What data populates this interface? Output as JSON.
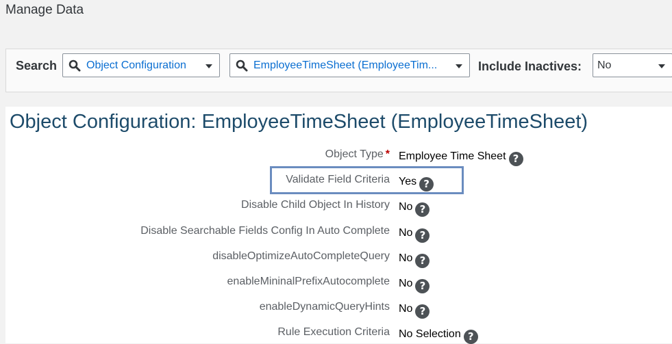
{
  "page": {
    "title": "Manage Data"
  },
  "search": {
    "label": "Search",
    "type_combo": {
      "value": "Object Configuration"
    },
    "object_combo": {
      "value": "EmployeeTimeSheet (EmployeeTim..."
    },
    "inactives_label": "Include Inactives:",
    "inactives_select": {
      "value": "No"
    }
  },
  "detail": {
    "title": "Object Configuration: EmployeeTimeSheet (EmployeeTimeSheet)",
    "required_mark": "*",
    "help_glyph": "?",
    "fields": [
      {
        "label": "Object Type",
        "value": "Employee Time Sheet"
      },
      {
        "label": "Validate Field Criteria",
        "value": "Yes"
      },
      {
        "label": "Disable Child Object In History",
        "value": "No"
      },
      {
        "label": "Disable Searchable Fields Config In Auto Complete",
        "value": "No"
      },
      {
        "label": "disableOptimizeAutoCompleteQuery",
        "value": "No"
      },
      {
        "label": "enableMininalPrefixAutocomplete",
        "value": "No"
      },
      {
        "label": "enableDynamicQueryHints",
        "value": "No"
      },
      {
        "label": "Rule Execution Criteria",
        "value": "No Selection"
      }
    ]
  },
  "colors": {
    "link_blue": "#0a6ed1",
    "title_blue": "#1d4b6a",
    "highlight_border": "#6a8cbf",
    "required_red": "#bb0000"
  }
}
